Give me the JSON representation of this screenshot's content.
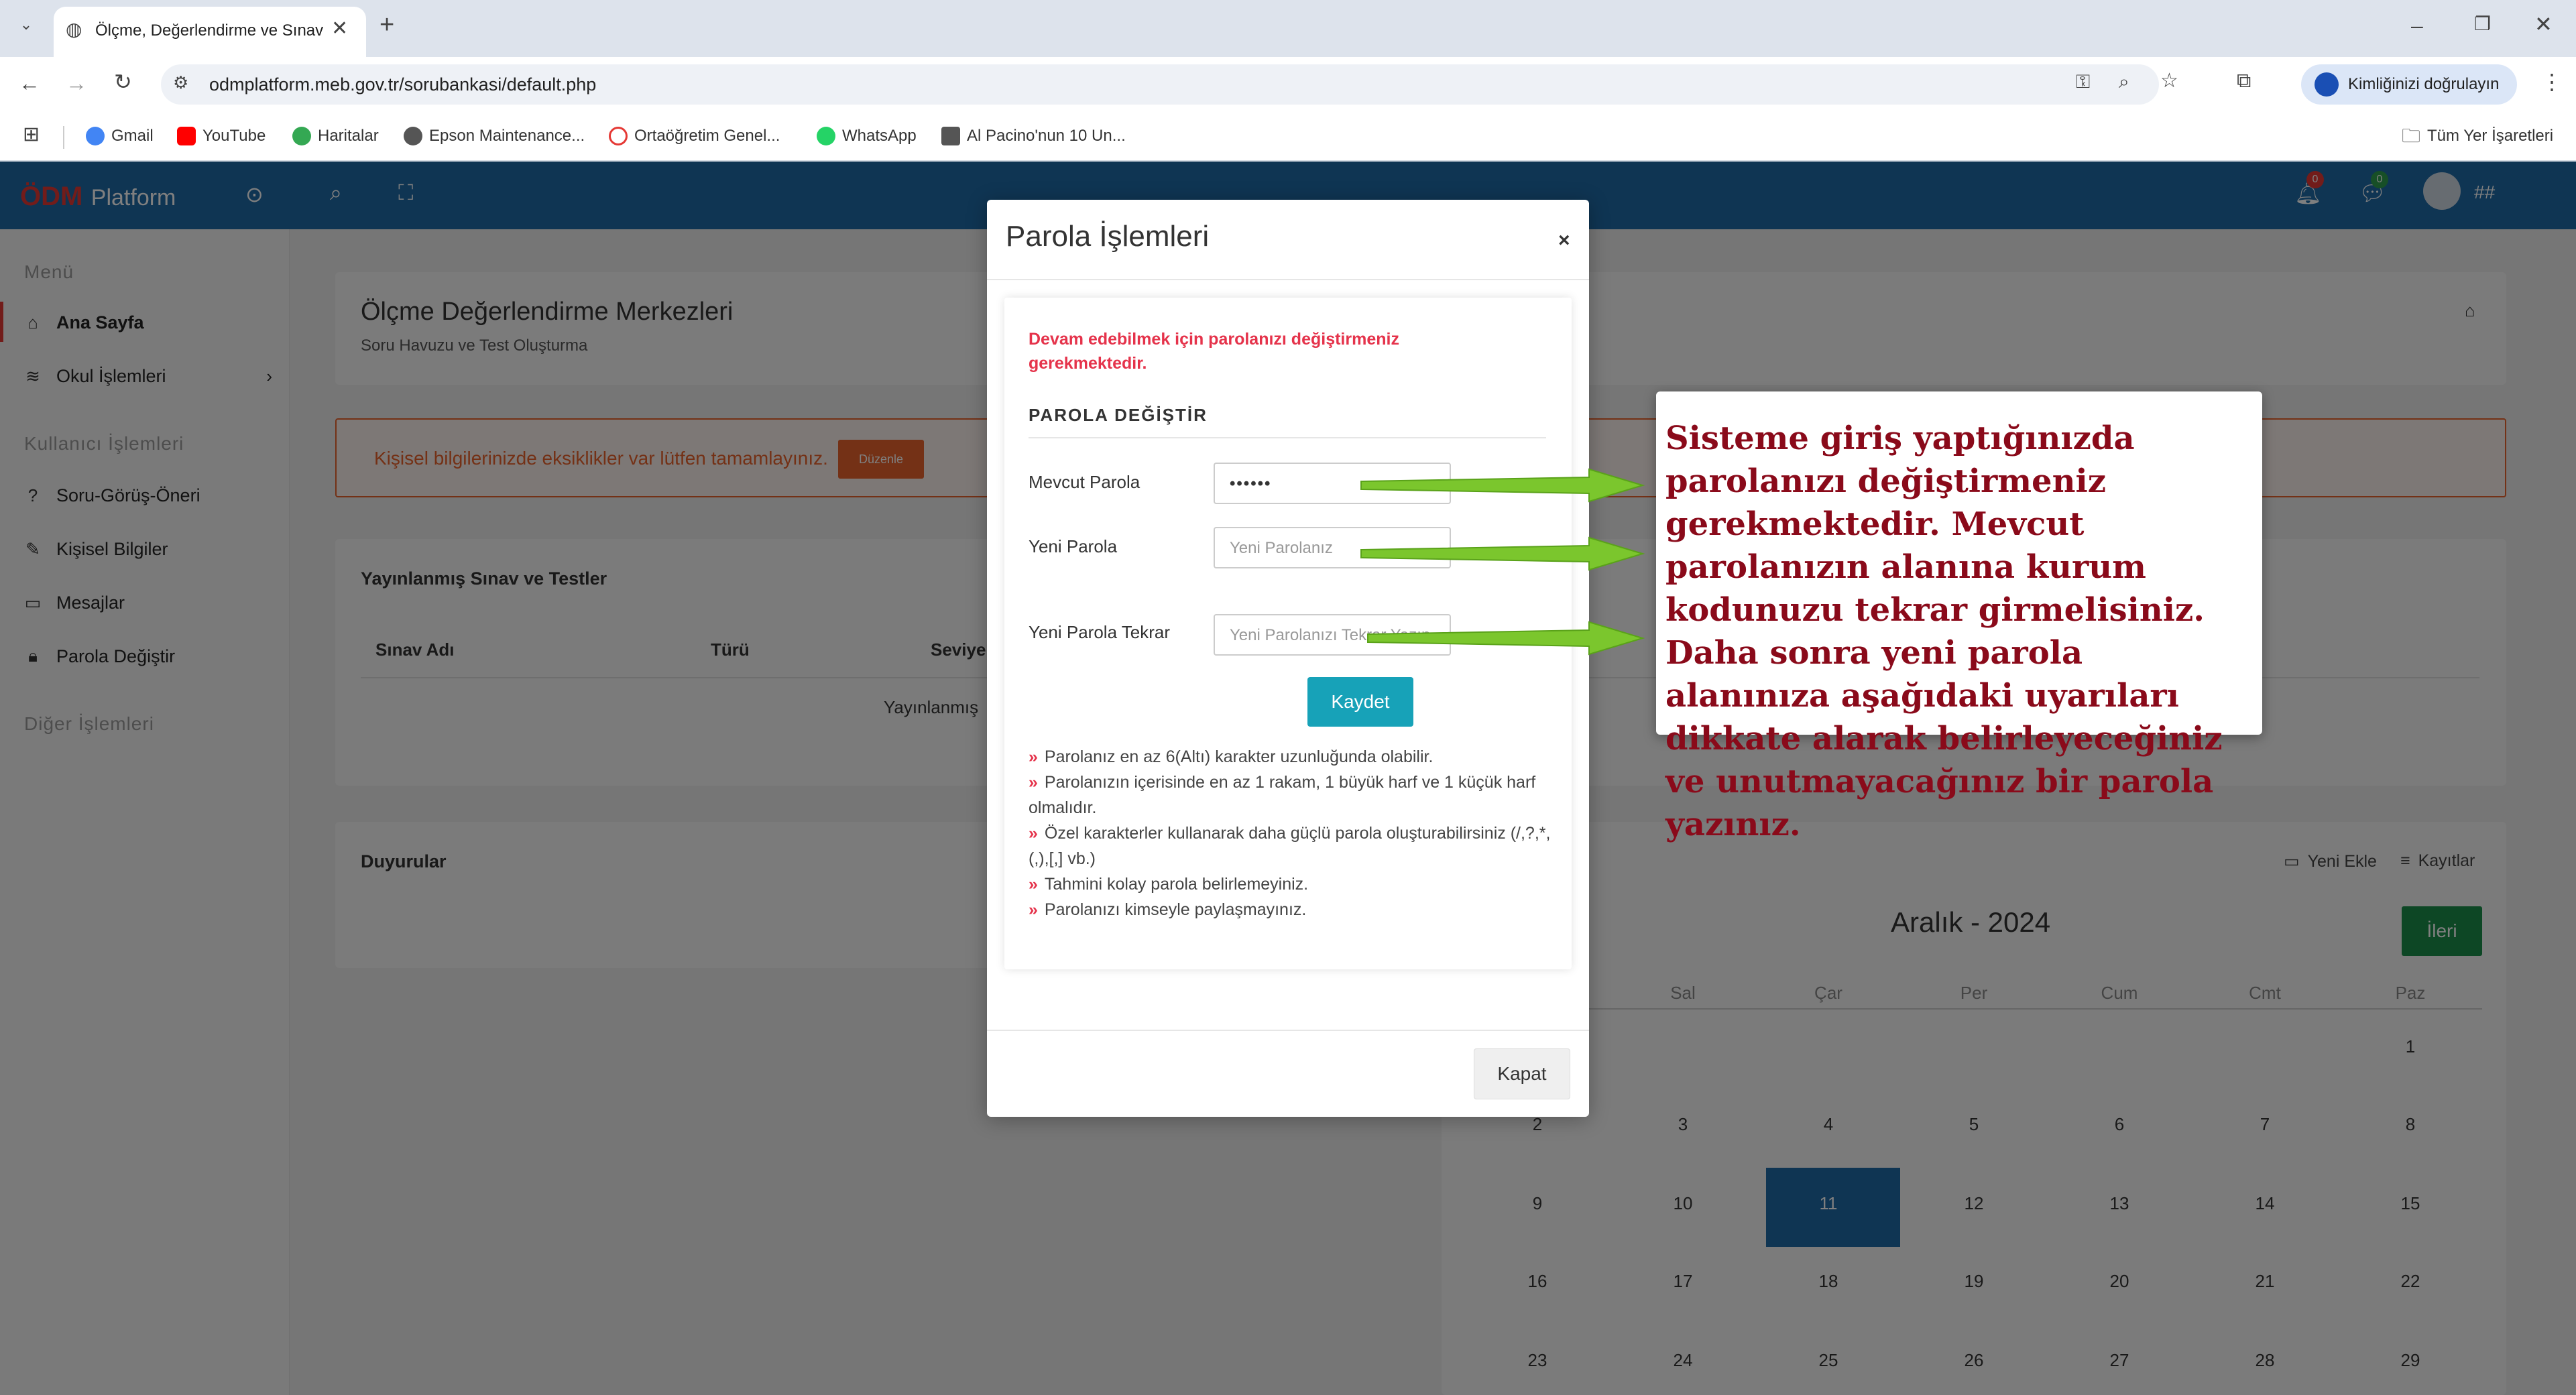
{
  "browser": {
    "tab_title": "Ölçme, Değerlendirme ve Sınav",
    "new_tab": "+",
    "url": "odmplatform.meb.gov.tr/sorubankasi/default.php",
    "profile_label": "Kimliğinizi doğrulayın",
    "bookmarks": [
      {
        "label": "Gmail",
        "icon": "google-icon",
        "color": "#4285f4"
      },
      {
        "label": "YouTube",
        "icon": "youtube-icon",
        "color": "#ff0000"
      },
      {
        "label": "Haritalar",
        "icon": "maps-pin-icon",
        "color": "#34a853"
      },
      {
        "label": "Epson Maintenance...",
        "icon": "globe-icon",
        "color": "#555555"
      },
      {
        "label": "Ortaöğretim Genel...",
        "icon": "meb-logo-icon",
        "color": "#e53935"
      },
      {
        "label": "WhatsApp",
        "icon": "whatsapp-icon",
        "color": "#25d366"
      },
      {
        "label": "Al Pacino'nun 10 Un...",
        "icon": "page-icon",
        "color": "#555555"
      }
    ],
    "all_bookmarks": "Tüm Yer İşaretleri"
  },
  "app": {
    "logo_main": "ÖDM",
    "logo_sub": "Platform",
    "user_label": "##",
    "notif_count_1": "0",
    "notif_count_2": "0"
  },
  "sidebar": {
    "menu_header": "Menü",
    "items": [
      {
        "label": "Ana Sayfa",
        "icon": "home-icon"
      },
      {
        "label": "Okul İşlemleri",
        "icon": "layers-icon"
      }
    ],
    "user_header": "Kullanıcı İşlemleri",
    "user_items": [
      {
        "label": "Soru-Görüş-Öneri",
        "icon": "help-circle-icon"
      },
      {
        "label": "Kişisel Bilgiler",
        "icon": "edit-icon"
      },
      {
        "label": "Mesajlar",
        "icon": "message-icon"
      },
      {
        "label": "Parola Değiştir",
        "icon": "lock-icon"
      }
    ],
    "other_header": "Diğer İşlemleri"
  },
  "main": {
    "page_title": "Ölçme Değerlendirme Merkezleri",
    "page_subtitle": "Soru Havuzu ve Test Oluşturma",
    "alert_text": "Kişisel bilgilerinizde eksiklikler var lütfen tamamlayınız.",
    "alert_button": "Düzenle",
    "exams_title": "Yayınlanmış Sınav ve Testler",
    "exams_columns": [
      "Sınav Adı",
      "Türü",
      "Seviye"
    ],
    "exams_empty": "Yayınlanmış",
    "announcements_title": "Duyurular"
  },
  "calendar": {
    "add_label": "Yeni Ekle",
    "records_label": "Kayıtlar",
    "month": "Aralık - 2024",
    "next_button": "İleri",
    "weekdays": [
      "Sal",
      "Çar",
      "Per",
      "Cum",
      "Cmt",
      "Paz"
    ],
    "weeks": [
      [
        "",
        "",
        "",
        "",
        "",
        "",
        "1"
      ],
      [
        "2",
        "3",
        "4",
        "5",
        "6",
        "7",
        "8"
      ],
      [
        "9",
        "10",
        "11",
        "12",
        "13",
        "14",
        "15"
      ],
      [
        "16",
        "17",
        "18",
        "19",
        "20",
        "21",
        "22"
      ],
      [
        "23",
        "24",
        "25",
        "26",
        "27",
        "28",
        "29"
      ]
    ],
    "today": "11"
  },
  "modal": {
    "title": "Parola İşlemleri",
    "close_x": "×",
    "warning": "Devam edebilmek için parolanızı değiştirmeniz gerekmektedir.",
    "section_title": "PAROLA DEĞİŞTİR",
    "current_label": "Mevcut Parola",
    "current_value": "••••••",
    "new_label": "Yeni Parola",
    "new_placeholder": "Yeni Parolanız",
    "confirm_label": "Yeni Parola Tekrar",
    "confirm_placeholder": "Yeni Parolanızı Tekrar Yazın",
    "save_button": "Kaydet",
    "rules": [
      "Parolanız en az 6(Altı) karakter uzunluğunda olabilir.",
      "Parolanızın içerisinde en az 1 rakam, 1 büyük harf ve 1 küçük harf olmalıdır.",
      "Özel karakterler kullanarak daha güçlü parola oluşturabilirsiniz (/,?,*,(,),[,] vb.)",
      "Tahmini kolay parola belirlemeyiniz.",
      "Parolanızı kimseyle paylaşmayınız."
    ],
    "close_button": "Kapat"
  },
  "callout": {
    "text": "Sisteme giriş yaptığınızda parolanızı değiştirmeniz gerekmektedir. Mevcut parolanızın alanına kurum kodunuzu tekrar girmelisiniz. Daha sonra yeni parola alanınıza aşağıdaki uyarıları dikkate alarak belirleyeceğiniz ve unutmayacağınız bir parola yazınız."
  },
  "colors": {
    "header_blue": "#1e6aa6",
    "arrow_green": "#7bc62d",
    "callout_text": "#8a0a1a",
    "save_teal": "#17a2b8",
    "next_green": "#1a8f4b",
    "today_blue": "#1e6aa6",
    "alert_orange": "#e8622c"
  }
}
